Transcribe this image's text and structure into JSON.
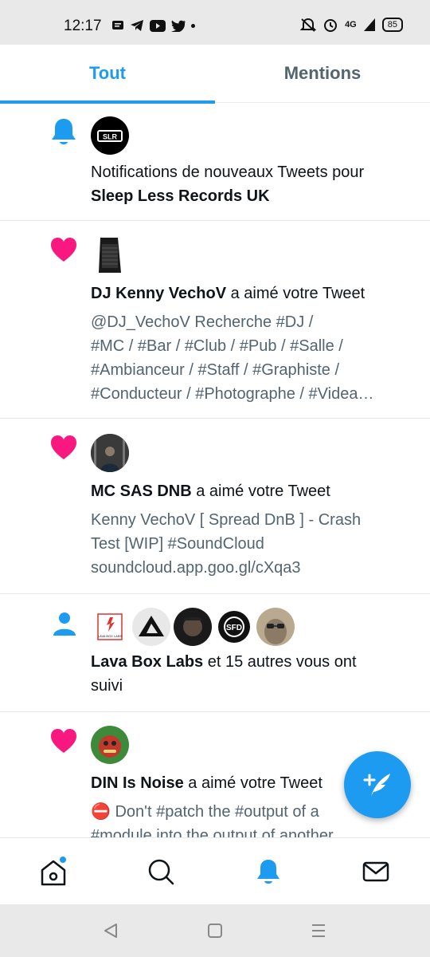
{
  "status_bar": {
    "time": "12:17",
    "network": "4G",
    "battery": "85"
  },
  "tabs": [
    {
      "label": "Tout",
      "active": true
    },
    {
      "label": "Mentions",
      "active": false
    }
  ],
  "notifications": [
    {
      "type": "bell",
      "title_prefix": "Notifications de nouveaux Tweets pour",
      "name": "Sleep Less Records UK",
      "avatar_text": "SLR"
    },
    {
      "type": "like",
      "name": "DJ Kenny VechoV",
      "action": "a aimé votre Tweet",
      "tweet_lines": [
        "@DJ_VechoV Recherche #DJ /",
        "#MC / #Bar / #Club / #Pub / #Salle  /",
        "#Ambianceur / #Staff / #Graphiste /",
        "#Conducteur / #Photographe / #Videa…"
      ]
    },
    {
      "type": "like",
      "name": "MC SAS DNB",
      "action": "a aimé votre Tweet",
      "tweet_lines": [
        "Kenny VechoV [ Spread DnB ] - Crash",
        "Test [WIP] #SoundCloud",
        "soundcloud.app.goo.gl/cXqa3"
      ]
    },
    {
      "type": "follow",
      "name": "Lava Box Labs",
      "action_line1": "et 15 autres vous ont",
      "action_line2": "suivi",
      "avatar_labels": [
        "LAVA BOX LABS",
        "SFD"
      ]
    },
    {
      "type": "like",
      "name": "DIN Is Noise",
      "action": "a aimé votre Tweet",
      "tweet_lines": [
        "⛔ Don't #patch the #output of a",
        "#module into the output of another"
      ]
    }
  ],
  "icons": {
    "bell": "bell-icon",
    "like": "heart-icon",
    "follow": "person-icon",
    "compose": "compose-tweet-icon",
    "nav": [
      "home-icon",
      "search-icon",
      "notifications-icon",
      "messages-icon"
    ]
  },
  "colors": {
    "accent": "#1d9bf0",
    "heart": "#f91880",
    "text_secondary": "#536471"
  }
}
